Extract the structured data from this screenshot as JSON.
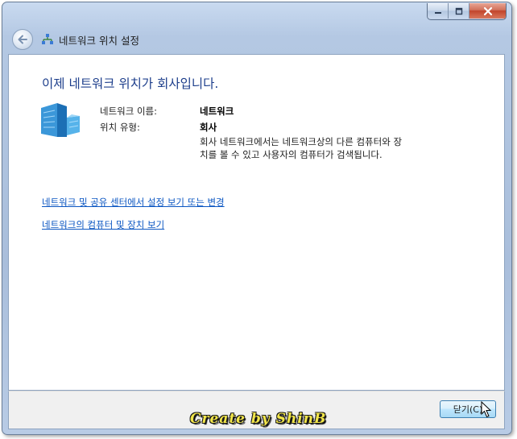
{
  "window": {
    "title": "네트워크 위치 설정",
    "caption_buttons": [
      "minimize",
      "maximize",
      "close"
    ]
  },
  "main": {
    "heading": "이제 네트워크 위치가 회사입니다.",
    "network_name_label": "네트워크 이름:",
    "network_name_value": "네트워크",
    "location_type_label": "위치 유형:",
    "location_type_value": "회사",
    "description_line1": "회사 네트워크에서는 네트워크상의 다른 컴퓨터와 장",
    "description_line2": "치를 볼 수 있고 사용자의 컴퓨터가 검색됩니다.",
    "links": [
      "네트워크 및 공유 센터에서 설정 보기 또는 변경",
      "네트워크의 컴퓨터 및 장치 보기"
    ]
  },
  "footer": {
    "close_label": "닫기(C)"
  },
  "watermark": {
    "text": "Create by ShinB"
  },
  "icons": {
    "back": "back-arrow-icon",
    "network": "network-icon",
    "building": "office-building-icon",
    "cursor": "mouse-cursor-icon"
  },
  "colors": {
    "heading": "#1e3f8c",
    "link": "#0b56c2",
    "frame": "#b4c8e3",
    "close_caption": "#c1442b"
  }
}
